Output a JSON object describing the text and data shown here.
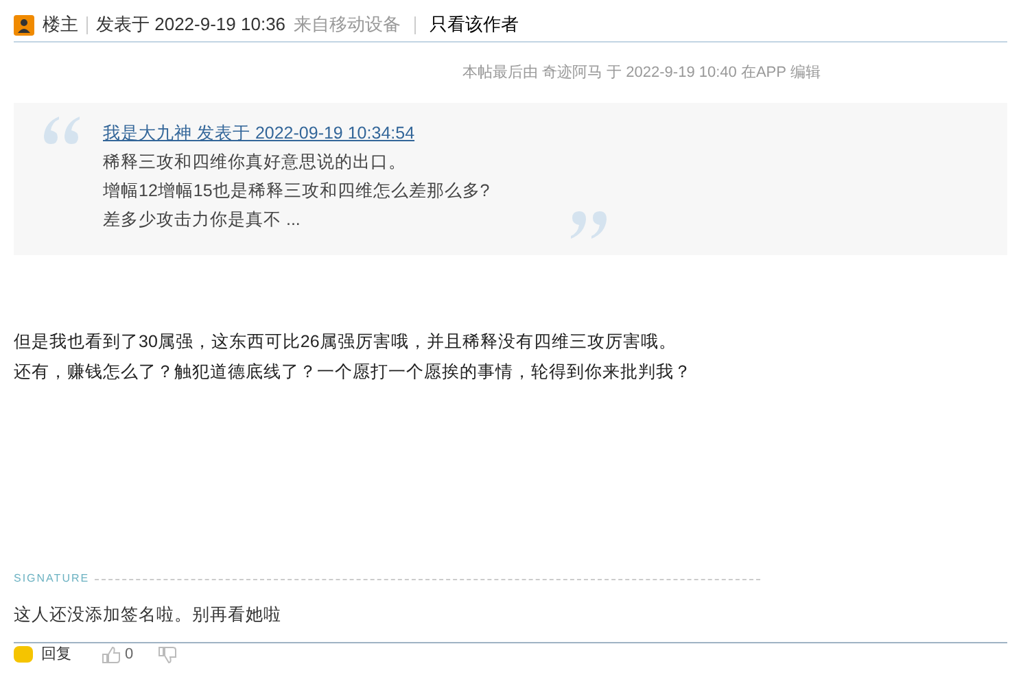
{
  "header": {
    "role": "楼主",
    "posted": "发表于 2022-9-19 10:36",
    "source": "来自移动设备",
    "author_only": "只看该作者"
  },
  "edit_note": "本帖最后由 奇迹阿马 于 2022-9-19 10:40 在APP 编辑",
  "quote": {
    "link": "我是大九神 发表于 2022-09-19 10:34:54",
    "lines": [
      "稀释三攻和四维你真好意思说的出口。",
      "增幅12增幅15也是稀释三攻和四维怎么差那么多?",
      "差多少攻击力你是真不 ..."
    ]
  },
  "body": [
    "但是我也看到了30属强，这东西可比26属强厉害哦，并且稀释没有四维三攻厉害哦。",
    "还有，赚钱怎么了？触犯道德底线了？一个愿打一个愿挨的事情，轮得到你来批判我？"
  ],
  "signature": {
    "label": "SIGNATURE",
    "text": "这人还没添加签名啦。别再看她啦"
  },
  "actions": {
    "reply": "回复",
    "likes": "0"
  }
}
